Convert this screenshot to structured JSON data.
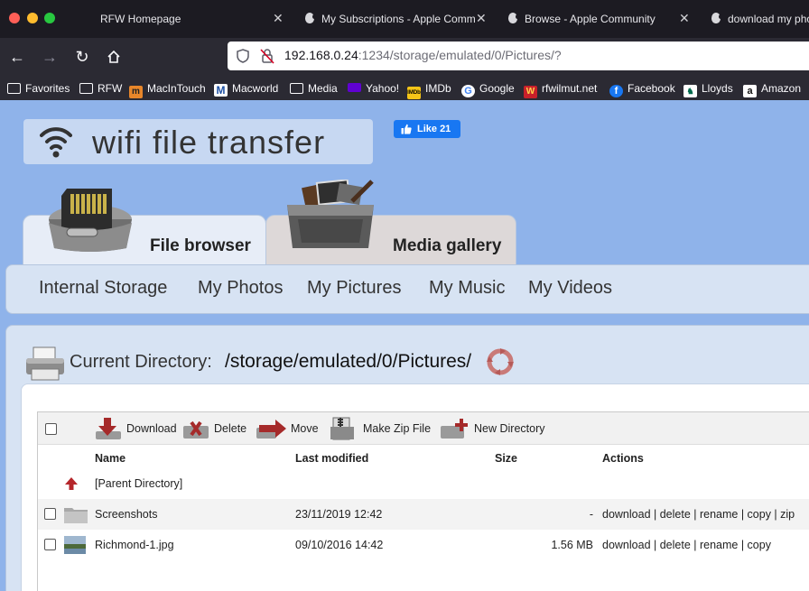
{
  "browser": {
    "tabs": [
      {
        "title": "RFW Homepage",
        "icon": "none"
      },
      {
        "title": "My Subscriptions - Apple Comm",
        "icon": "apple-icon"
      },
      {
        "title": "Browse - Apple Community",
        "icon": "apple-icon"
      },
      {
        "title": "download my pho",
        "icon": "apple-icon"
      }
    ],
    "url_host": "192.168.0.24",
    "url_rest": ":1234/storage/emulated/0/Pictures/?",
    "bookmarks": [
      {
        "label": "Favorites",
        "icon": "folder-icon"
      },
      {
        "label": "RFW",
        "icon": "folder-icon"
      },
      {
        "label": "MacInTouch",
        "icon": "macintouch-icon"
      },
      {
        "label": "Macworld",
        "icon": "macworld-icon"
      },
      {
        "label": "Media",
        "icon": "folder-icon"
      },
      {
        "label": "Yahoo!",
        "icon": "yahoo-icon"
      },
      {
        "label": "IMDb",
        "icon": "imdb-icon"
      },
      {
        "label": "Google",
        "icon": "google-icon"
      },
      {
        "label": "rfwilmut.net",
        "icon": "rfw-icon"
      },
      {
        "label": "Facebook",
        "icon": "facebook-icon"
      },
      {
        "label": "Lloyds",
        "icon": "lloyds-icon"
      },
      {
        "label": "Amazon",
        "icon": "amazon-icon"
      }
    ]
  },
  "app": {
    "logo_text": "wifi file transfer",
    "like_label": "Like 21",
    "main_tabs": [
      {
        "label": "File browser",
        "active": true
      },
      {
        "label": "Media gallery",
        "active": false
      }
    ],
    "subnav": [
      "Internal Storage",
      "My Photos",
      "My Pictures",
      "My Music",
      "My Videos"
    ],
    "current_directory_label": "Current Directory:",
    "current_directory_path": "/storage/emulated/0/Pictures/",
    "toolbar": {
      "download": "Download",
      "delete": "Delete",
      "move": "Move",
      "zip": "Make Zip File",
      "new_dir": "New Directory"
    },
    "columns": {
      "name": "Name",
      "modified": "Last modified",
      "size": "Size",
      "actions": "Actions"
    },
    "parent_label": "[Parent Directory]",
    "rows": [
      {
        "name": "Screenshots",
        "modified": "23/11/2019 12:42",
        "size": "-",
        "actions": "download | delete | rename | copy | zip",
        "kind": "folder-icon"
      },
      {
        "name": "Richmond-1.jpg",
        "modified": "09/10/2016 14:42",
        "size": "1.56 MB",
        "actions": "download | delete | rename | copy",
        "kind": "image-thumbnail"
      }
    ]
  },
  "colors": {
    "page_bg": "#8fb3ea",
    "panel_bg": "#d7e3f3",
    "browser_dark": "#1c1b22",
    "toolbar_dark": "#2b2a33",
    "accent_red": "#b5262a",
    "facebook_blue": "#1877f2"
  }
}
